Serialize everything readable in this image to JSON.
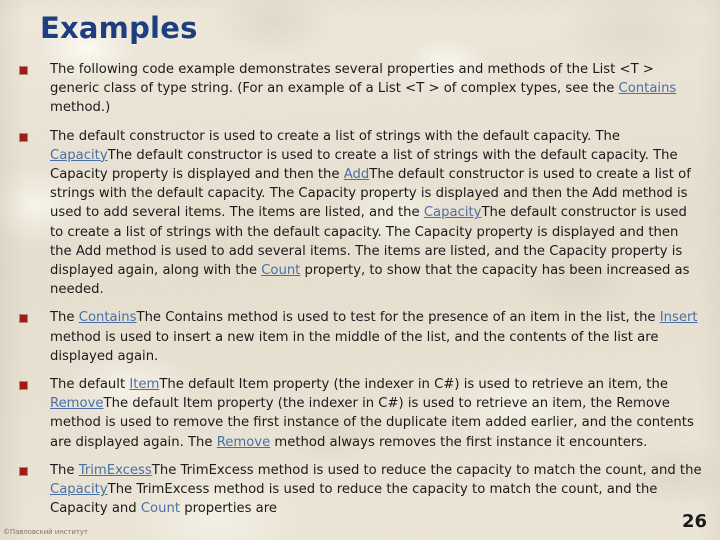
{
  "slide": {
    "title": "Examples",
    "page_number": "26",
    "watermark": "©Павловский институт",
    "colors": {
      "title": "#1d3f80",
      "bullet": "#9e1b16",
      "link": "#4a6fa5",
      "text": "#1b1b1b",
      "background": "#e9e3d5"
    }
  },
  "bullets": [
    {
      "id": "bullet-1",
      "runs": [
        {
          "t": "The following code example demonstrates several properties and methods of the List <T > generic class of type string. (For an example of a List <T > of complex types, see the ",
          "k": "text"
        },
        {
          "t": "Contains",
          "k": "link"
        },
        {
          "t": " method.)",
          "k": "text"
        }
      ]
    },
    {
      "id": "bullet-2",
      "runs": [
        {
          "t": "The default constructor is used to create a list of strings with the default capacity. The ",
          "k": "text"
        },
        {
          "t": "Capacity",
          "k": "link"
        },
        {
          "t": "The default constructor is used to create a list of strings with the default capacity. The Capacity property is displayed and then the ",
          "k": "text"
        },
        {
          "t": "Add",
          "k": "link"
        },
        {
          "t": "The default constructor is used to create a list of strings with the default capacity. The Capacity property is displayed and then the Add method is used to add several items. The items are listed, and the ",
          "k": "text"
        },
        {
          "t": "Capacity",
          "k": "link"
        },
        {
          "t": "The default constructor is used to create a list of strings with the default capacity. The Capacity property is displayed and then the Add method is used to add several items. The items are listed, and the Capacity property is displayed again, along with the ",
          "k": "text"
        },
        {
          "t": "Count",
          "k": "link"
        },
        {
          "t": " property, to show that the capacity has been increased as needed.",
          "k": "text"
        }
      ]
    },
    {
      "id": "bullet-3",
      "runs": [
        {
          "t": "The ",
          "k": "text"
        },
        {
          "t": "Contains",
          "k": "link"
        },
        {
          "t": "The Contains method is used to test for the presence of an item in the list, the ",
          "k": "text"
        },
        {
          "t": "Insert",
          "k": "link"
        },
        {
          "t": " method is used to insert a new item in the middle of the list, and the contents of the list are displayed again.",
          "k": "text"
        }
      ]
    },
    {
      "id": "bullet-4",
      "runs": [
        {
          "t": "The default ",
          "k": "text"
        },
        {
          "t": "Item",
          "k": "link"
        },
        {
          "t": "The default Item property (the indexer in C#) is used to retrieve an item, the ",
          "k": "text"
        },
        {
          "t": "Remove",
          "k": "link"
        },
        {
          "t": "The default Item property (the indexer in C#) is used to retrieve an item, the Remove method is used to remove the first instance of the duplicate item added earlier, and the contents are displayed again. The ",
          "k": "text"
        },
        {
          "t": "Remove",
          "k": "link"
        },
        {
          "t": " method always removes the first instance it encounters.",
          "k": "text"
        }
      ]
    },
    {
      "id": "bullet-5",
      "runs": [
        {
          "t": "The ",
          "k": "text"
        },
        {
          "t": "TrimExcess",
          "k": "link"
        },
        {
          "t": "The TrimExcess method is used to reduce the capacity to match the count, and the ",
          "k": "text"
        },
        {
          "t": "Capacity",
          "k": "link"
        },
        {
          "t": "The TrimExcess method is used to reduce the capacity to match the count, and the Capacity and ",
          "k": "text"
        },
        {
          "t": "Count",
          "k": "link-plain"
        },
        {
          "t": " properties are",
          "k": "text"
        }
      ]
    }
  ]
}
